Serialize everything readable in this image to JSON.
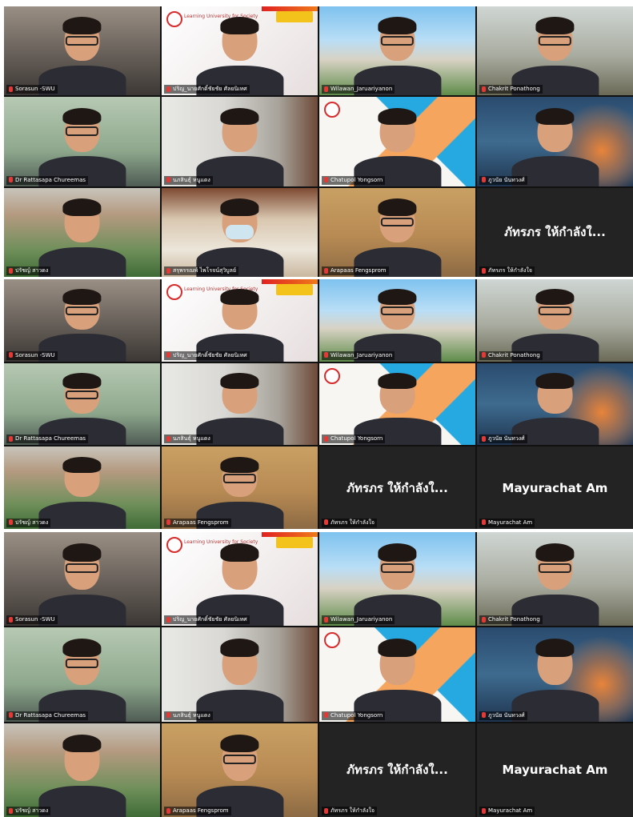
{
  "panels": [
    {
      "tiles": [
        {
          "name": "Sorasun -SWU",
          "bg": "office",
          "glasses": true
        },
        {
          "name": "ปริญ_นายศักดิ์ชัยชัย ศัลยนิเทศ",
          "bg": "slide",
          "slide_text": "Learning University for Society",
          "badge": true
        },
        {
          "name": "Wilawan_Jaruariyanon",
          "bg": "campus",
          "glasses": true
        },
        {
          "name": "Chakrit Ponathong",
          "bg": "shelf",
          "glasses": true
        },
        {
          "name": "Dr Rattasapa Chureemas",
          "bg": "green",
          "glasses": true
        },
        {
          "name": "นภสินธุ์ หนูแดง",
          "bg": "curtain"
        },
        {
          "name": "Chatupol Yongsorn",
          "bg": "tri",
          "active": true
        },
        {
          "name": "ภูวนัย นันทวงศ์",
          "bg": "storm"
        },
        {
          "name": "ปรัชญ์ สาวดง",
          "bg": "building"
        },
        {
          "name": "สรุพรรณพ์ ไพโรจน์สุวิบูลย์",
          "bg": "room",
          "mask": true
        },
        {
          "name": "Arapaas Fengsprom",
          "bg": "wood",
          "glasses": true
        },
        {
          "name": "ภัทรภร ให้กำลังใจ",
          "bg": "black",
          "display_name": "ภัทรภร ให้กำลังใ..."
        }
      ]
    },
    {
      "tiles": [
        {
          "name": "Sorasun -SWU",
          "bg": "office",
          "glasses": true
        },
        {
          "name": "ปริญ_นายศักดิ์ชัยชัย ศัลยนิเทศ",
          "bg": "slide",
          "slide_text": "Learning University for Society",
          "badge": true
        },
        {
          "name": "Wilawan_Jaruariyanon",
          "bg": "campus",
          "glasses": true
        },
        {
          "name": "Chakrit Ponathong",
          "bg": "shelf",
          "glasses": true
        },
        {
          "name": "Dr Rattasapa Chureemas",
          "bg": "green",
          "glasses": true
        },
        {
          "name": "นภสินธุ์ หนูแดง",
          "bg": "curtain"
        },
        {
          "name": "Chatupol Yongsorn",
          "bg": "tri"
        },
        {
          "name": "ภูวนัย นันทวงศ์",
          "bg": "storm"
        },
        {
          "name": "ปรัชญ์ สาวดง",
          "bg": "building"
        },
        {
          "name": "Arapaas Fengsprom",
          "bg": "wood",
          "glasses": true
        },
        {
          "name": "ภัทรภร ให้กำลังใจ",
          "bg": "black",
          "display_name": "ภัทรภร ให้กำลังใ..."
        },
        {
          "name": "Mayurachat Am",
          "bg": "black",
          "display_name": "Mayurachat Am"
        }
      ]
    },
    {
      "tiles": [
        {
          "name": "Sorasun -SWU",
          "bg": "office",
          "glasses": true
        },
        {
          "name": "ปริญ_นายศักดิ์ชัยชัย ศัลยนิเทศ",
          "bg": "slide",
          "slide_text": "Learning University for Society",
          "badge": true
        },
        {
          "name": "Wilawan_Jaruariyanon",
          "bg": "campus",
          "glasses": true
        },
        {
          "name": "Chakrit Ponathong",
          "bg": "shelf",
          "glasses": true
        },
        {
          "name": "Dr Rattasapa Chureemas",
          "bg": "green",
          "glasses": true
        },
        {
          "name": "นภสินธุ์ หนูแดง",
          "bg": "curtain"
        },
        {
          "name": "Chatupol Yongsorn",
          "bg": "tri",
          "active": true
        },
        {
          "name": "ภูวนัย นันทวงศ์",
          "bg": "storm"
        },
        {
          "name": "ปรัชญ์ สาวดง",
          "bg": "building"
        },
        {
          "name": "Arapaas Fengsprom",
          "bg": "wood",
          "glasses": true
        },
        {
          "name": "ภัทรภร ให้กำลังใจ",
          "bg": "black",
          "display_name": "ภัทรภร ให้กำลังใ..."
        },
        {
          "name": "Mayurachat Am",
          "bg": "black",
          "display_name": "Mayurachat Am"
        }
      ]
    }
  ],
  "colors": {
    "active_speaker_border": "#b8d235",
    "muted_mic": "#e53935",
    "name_label_bg": "rgba(0,0,0,0.55)"
  }
}
